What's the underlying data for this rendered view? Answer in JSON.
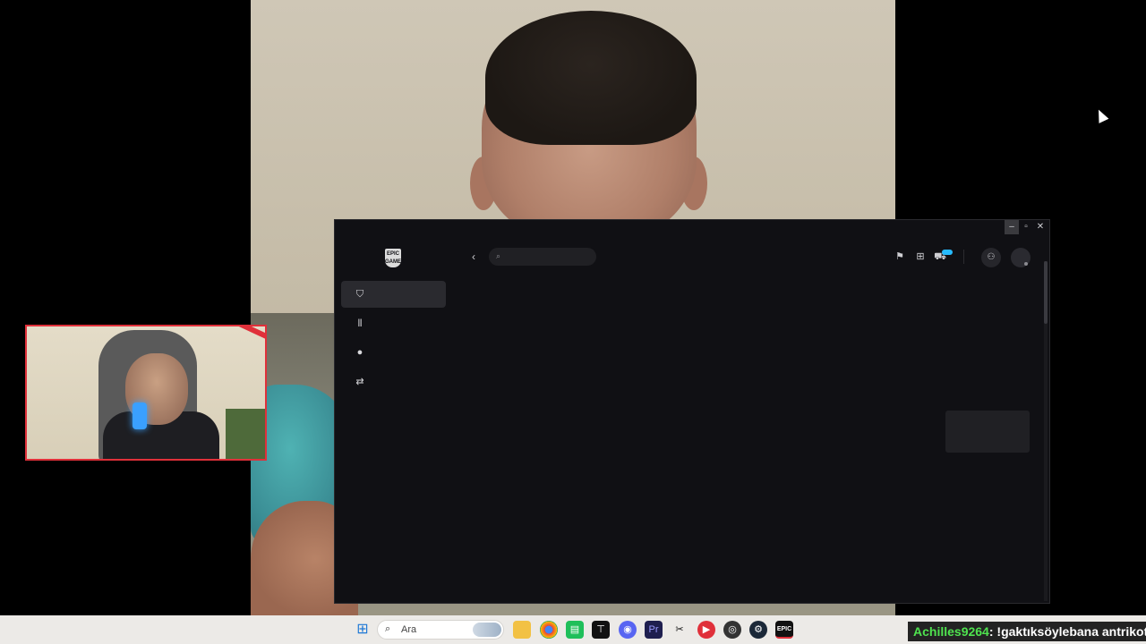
{
  "taskbar": {
    "search_label": "Ara"
  },
  "epic": {
    "logo_text": "EPIC GAMES",
    "search_placeholder": "",
    "nav": [
      {
        "id": "store",
        "icon": "store-bag-icon",
        "active": true
      },
      {
        "id": "library",
        "icon": "library-icon",
        "active": false
      },
      {
        "id": "unreal",
        "icon": "unreal-engine-icon",
        "active": false
      },
      {
        "id": "link",
        "icon": "link-icon",
        "active": false
      }
    ]
  },
  "chat": {
    "user": "Achilles9264",
    "separator": ": ",
    "message": "!gaktıksöylebana antrikot"
  },
  "colors": {
    "accent": "#26bbff",
    "window_bg": "#101014",
    "chat_user": "#4fe34f",
    "webcam_border": "#e0303a"
  }
}
